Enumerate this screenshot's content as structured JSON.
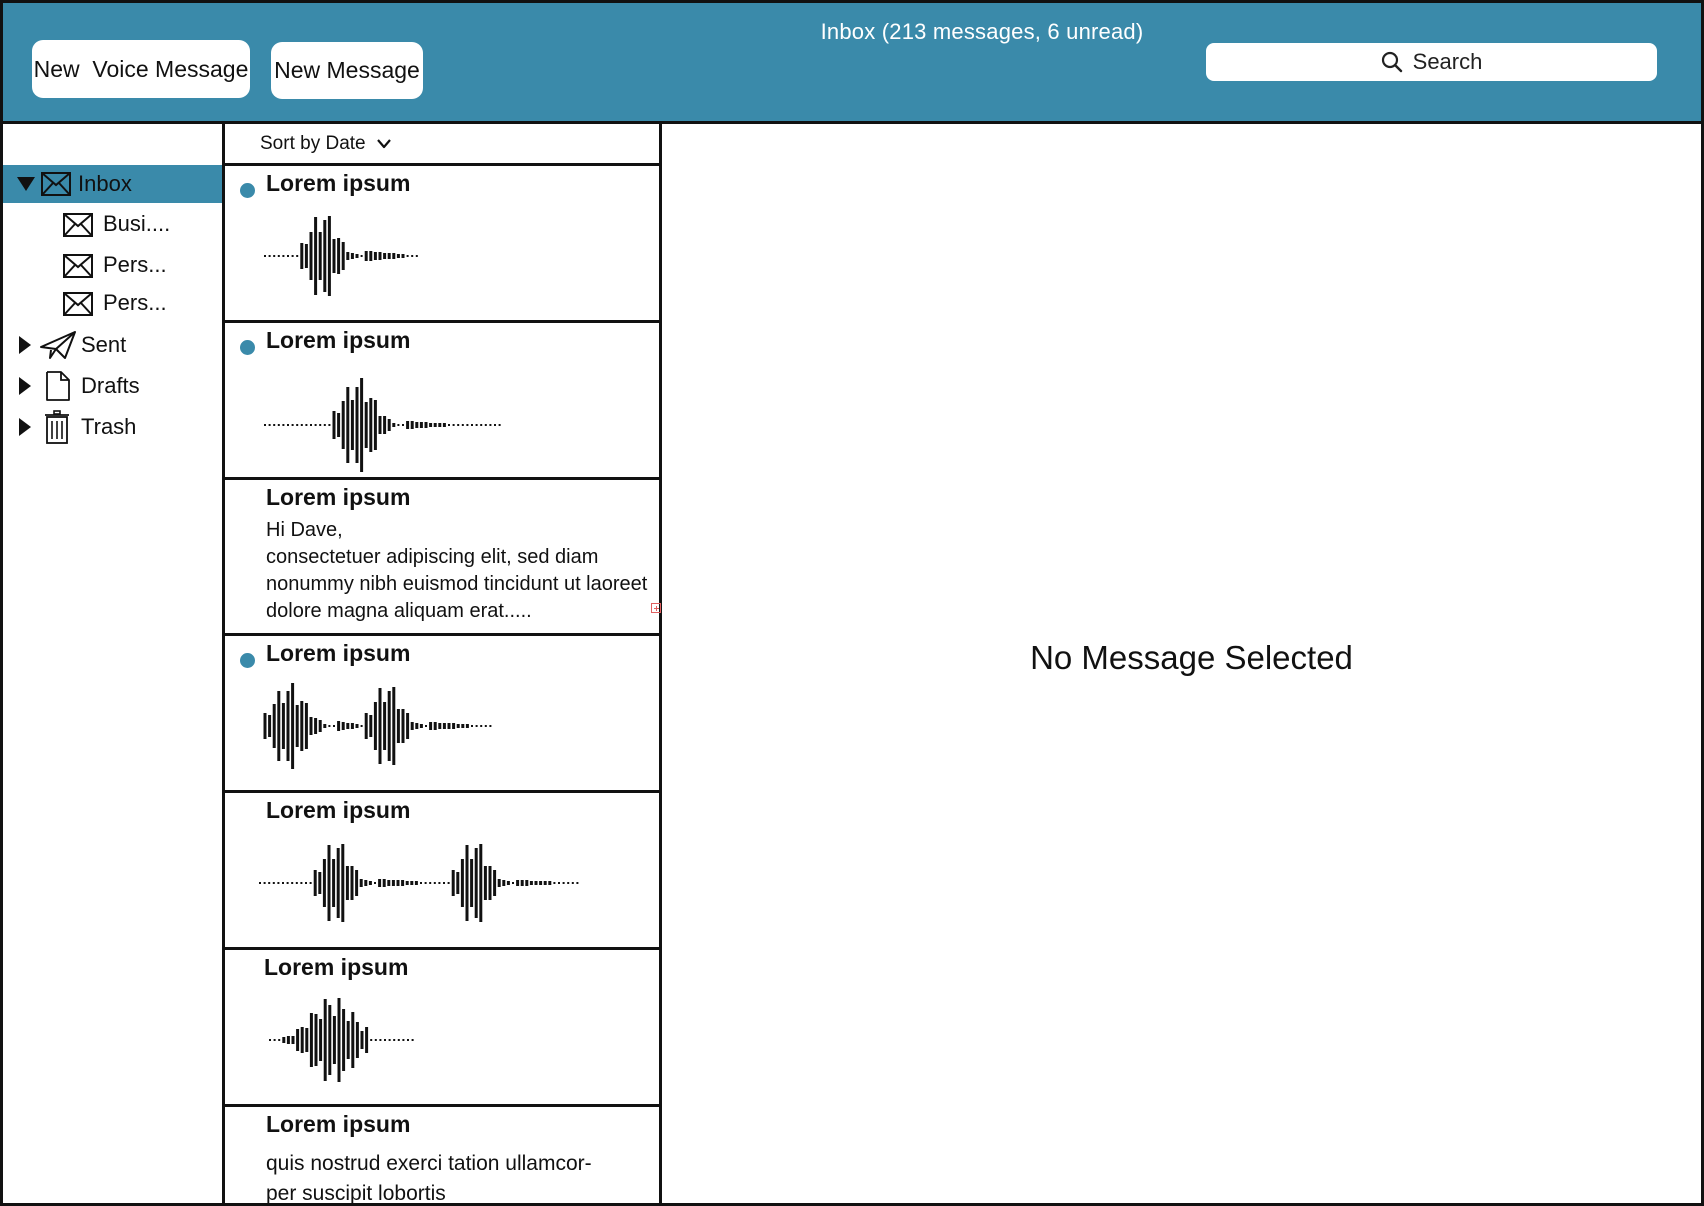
{
  "header": {
    "new_voice_label": "New  Voice Message",
    "new_message_label": "New Message",
    "title": "Inbox (213 messages, 6 unread)",
    "search_label": "Search",
    "accent_color": "#3a8aaa"
  },
  "sidebar": {
    "folders": [
      {
        "label": "Inbox",
        "icon": "envelope-icon",
        "expanded": true,
        "active": true
      },
      {
        "label": "Busi....",
        "icon": "envelope-icon",
        "sub": true
      },
      {
        "label": "Pers...",
        "icon": "envelope-icon",
        "sub": true
      },
      {
        "label": "Pers...",
        "icon": "envelope-icon",
        "sub": true
      },
      {
        "label": "Sent",
        "icon": "paper-plane-icon",
        "expanded": false
      },
      {
        "label": "Drafts",
        "icon": "document-icon",
        "expanded": false
      },
      {
        "label": "Trash",
        "icon": "trash-icon",
        "expanded": false
      }
    ]
  },
  "message_list": {
    "sort_label": "Sort by Date",
    "messages": [
      {
        "subject": "Lorem ipsum",
        "unread": true,
        "type": "voice"
      },
      {
        "subject": "Lorem ipsum",
        "unread": true,
        "type": "voice"
      },
      {
        "subject": "Lorem ipsum",
        "unread": false,
        "type": "text",
        "body": "Hi Dave,\nconsectetuer adipiscing elit, sed diam nonummy nibh euismod tincidunt ut laoreet dolore magna aliquam erat....."
      },
      {
        "subject": "Lorem ipsum",
        "unread": true,
        "type": "voice"
      },
      {
        "subject": "Lorem ipsum",
        "unread": false,
        "type": "voice"
      },
      {
        "subject": "Lorem ipsum",
        "unread": false,
        "type": "voice"
      },
      {
        "subject": "Lorem ipsum",
        "unread": false,
        "type": "text",
        "body": "quis nostrud exerci tation ullamcor-\nper suscipit lobortis"
      }
    ]
  },
  "reading_pane": {
    "empty_label": "No Message Selected"
  }
}
